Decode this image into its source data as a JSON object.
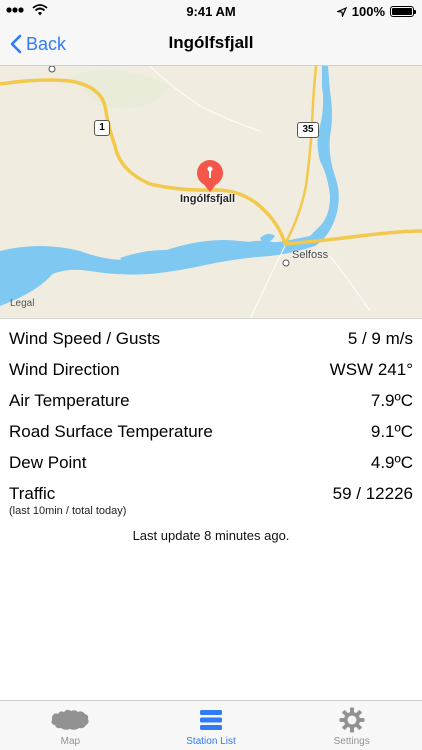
{
  "status_bar": {
    "time": "9:41 AM",
    "battery": "100%"
  },
  "nav": {
    "back_label": "Back",
    "title": "Ingólfsfjall"
  },
  "map": {
    "pin_label": "Ingólfsfjall",
    "town_label": "Selfoss",
    "legal": "Legal",
    "route_1": "1",
    "route_35": "35"
  },
  "readings": [
    {
      "label": "Wind Speed / Gusts",
      "value": "5 / 9 m/s"
    },
    {
      "label": "Wind Direction",
      "value": "WSW 241°"
    },
    {
      "label": "Air Temperature",
      "value": "7.9ºC"
    },
    {
      "label": "Road Surface Temperature",
      "value": "9.1ºC"
    },
    {
      "label": "Dew Point",
      "value": "4.9ºC"
    }
  ],
  "traffic": {
    "label": "Traffic",
    "value": "59 / 12226",
    "note": "(last 10min / total today)"
  },
  "last_update": "Last update 8 minutes ago.",
  "tabs": [
    {
      "label": "Map",
      "icon": "iceland-map-icon",
      "active": false
    },
    {
      "label": "Station List",
      "icon": "list-icon",
      "active": true
    },
    {
      "label": "Settings",
      "icon": "gear-icon",
      "active": false
    }
  ],
  "colors": {
    "accent": "#2f7cf6",
    "pin": "#f4574a",
    "water": "#7fc8f2",
    "road": "#f2c94c",
    "land": "#f1ece0"
  }
}
